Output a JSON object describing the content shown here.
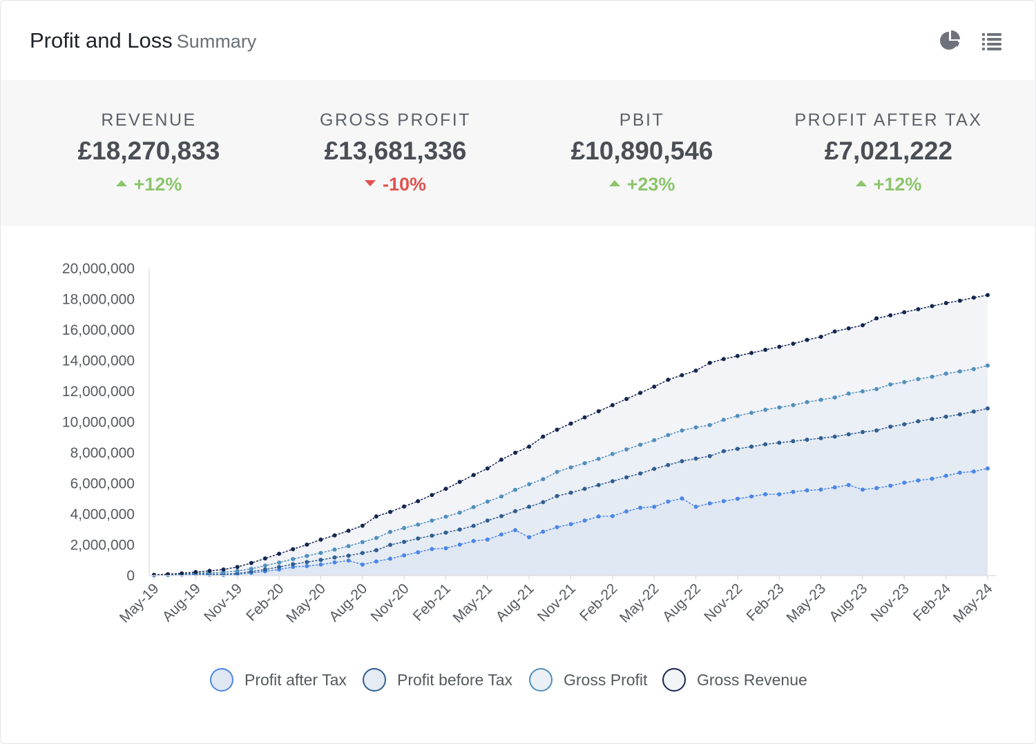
{
  "header": {
    "title": "Profit and Loss",
    "subtitle": "Summary",
    "icons": [
      "pie-chart-icon",
      "list-icon"
    ]
  },
  "kpis": [
    {
      "label": "REVENUE",
      "value": "£18,270,833",
      "change": "+12%",
      "direction": "up"
    },
    {
      "label": "GROSS PROFIT",
      "value": "£13,681,336",
      "change": "-10%",
      "direction": "down"
    },
    {
      "label": "PBIT",
      "value": "£10,890,546",
      "change": "+23%",
      "direction": "up"
    },
    {
      "label": "PROFIT AFTER TAX",
      "value": "£7,021,222",
      "change": "+12%",
      "direction": "up"
    }
  ],
  "colors": {
    "positive": "#8cc56b",
    "negative": "#e0524f",
    "series": [
      "#4a86e8",
      "#2f5d91",
      "#4f8fbd",
      "#14254f"
    ]
  },
  "chart_data": {
    "type": "area",
    "x": [
      "May-19",
      "Jun-19",
      "Jul-19",
      "Aug-19",
      "Sep-19",
      "Oct-19",
      "Nov-19",
      "Dec-19",
      "Jan-20",
      "Feb-20",
      "Mar-20",
      "Apr-20",
      "May-20",
      "Jun-20",
      "Jul-20",
      "Aug-20",
      "Sep-20",
      "Oct-20",
      "Nov-20",
      "Dec-20",
      "Jan-21",
      "Feb-21",
      "Mar-21",
      "Apr-21",
      "May-21",
      "Jun-21",
      "Jul-21",
      "Aug-21",
      "Sep-21",
      "Oct-21",
      "Nov-21",
      "Dec-21",
      "Jan-22",
      "Feb-22",
      "Mar-22",
      "Apr-22",
      "May-22",
      "Jun-22",
      "Jul-22",
      "Aug-22",
      "Sep-22",
      "Oct-22",
      "Nov-22",
      "Dec-22",
      "Jan-23",
      "Feb-23",
      "Mar-23",
      "Apr-23",
      "May-23",
      "Jun-23",
      "Jul-23",
      "Aug-23",
      "Sep-23",
      "Oct-23",
      "Nov-23",
      "Dec-23",
      "Jan-24",
      "Feb-24",
      "Mar-24",
      "Apr-24",
      "May-24"
    ],
    "x_tick_labels": [
      "May-19",
      "Aug-19",
      "Nov-19",
      "Feb-20",
      "May-20",
      "Aug-20",
      "Nov-20",
      "Feb-21",
      "May-21",
      "Aug-21",
      "Nov-21",
      "Feb-22",
      "May-22",
      "Aug-22",
      "Nov-22",
      "Feb-23",
      "May-23",
      "Aug-23",
      "Nov-23",
      "Feb-24",
      "May-24"
    ],
    "ylim": [
      0,
      20000000
    ],
    "y_ticks": [
      "0",
      "2,000,000",
      "4,000,000",
      "6,000,000",
      "8,000,000",
      "10,000,000",
      "12,000,000",
      "14,000,000",
      "16,000,000",
      "18,000,000",
      "20,000,000"
    ],
    "grid": false,
    "legend": "bottom",
    "series": [
      {
        "name": "Profit after Tax",
        "values": [
          20000,
          40000,
          60000,
          90000,
          60000,
          40000,
          80000,
          180000,
          280000,
          400000,
          560000,
          620000,
          720000,
          860000,
          980000,
          720000,
          920000,
          1100000,
          1320000,
          1520000,
          1730000,
          1780000,
          2020000,
          2250000,
          2350000,
          2680000,
          2960000,
          2500000,
          2860000,
          3150000,
          3350000,
          3580000,
          3850000,
          3880000,
          4180000,
          4420000,
          4480000,
          4820000,
          5020000,
          4480000,
          4700000,
          4850000,
          5000000,
          5150000,
          5300000,
          5300000,
          5450000,
          5550000,
          5600000,
          5750000,
          5900000,
          5600000,
          5700000,
          5850000,
          6050000,
          6200000,
          6300000,
          6500000,
          6700000,
          6780000,
          6980000
        ]
      },
      {
        "name": "Profit before Tax",
        "values": [
          30000,
          50000,
          80000,
          120000,
          110000,
          90000,
          140000,
          260000,
          400000,
          560000,
          740000,
          880000,
          1020000,
          1180000,
          1300000,
          1470000,
          1650000,
          2000000,
          2200000,
          2420000,
          2600000,
          2800000,
          3000000,
          3240000,
          3580000,
          3870000,
          4200000,
          4480000,
          4780000,
          5180000,
          5400000,
          5650000,
          5900000,
          6150000,
          6400000,
          6650000,
          6950000,
          7200000,
          7450000,
          7620000,
          7780000,
          8100000,
          8250000,
          8400000,
          8550000,
          8650000,
          8750000,
          8850000,
          8950000,
          9050000,
          9200000,
          9350000,
          9450000,
          9700000,
          9850000,
          10050000,
          10200000,
          10350000,
          10500000,
          10680000,
          10890000
        ]
      },
      {
        "name": "Gross Profit",
        "values": [
          40000,
          70000,
          110000,
          170000,
          190000,
          220000,
          300000,
          440000,
          650000,
          850000,
          1080000,
          1280000,
          1480000,
          1700000,
          1920000,
          2180000,
          2450000,
          2850000,
          3100000,
          3320000,
          3580000,
          3840000,
          4100000,
          4460000,
          4820000,
          5150000,
          5580000,
          5950000,
          6280000,
          6750000,
          7050000,
          7320000,
          7600000,
          7920000,
          8220000,
          8520000,
          8820000,
          9150000,
          9450000,
          9650000,
          9800000,
          10150000,
          10400000,
          10600000,
          10800000,
          10950000,
          11100000,
          11300000,
          11450000,
          11600000,
          11850000,
          12000000,
          12150000,
          12450000,
          12600000,
          12800000,
          12950000,
          13150000,
          13300000,
          13450000,
          13680000
        ]
      },
      {
        "name": "Gross Revenue",
        "values": [
          50000,
          90000,
          150000,
          230000,
          310000,
          400000,
          560000,
          820000,
          1120000,
          1420000,
          1720000,
          2020000,
          2340000,
          2620000,
          2920000,
          3250000,
          3850000,
          4150000,
          4500000,
          4850000,
          5250000,
          5650000,
          6100000,
          6550000,
          6980000,
          7550000,
          8000000,
          8400000,
          9050000,
          9500000,
          9900000,
          10300000,
          10700000,
          11100000,
          11500000,
          11900000,
          12300000,
          12750000,
          13050000,
          13350000,
          13850000,
          14100000,
          14300000,
          14500000,
          14700000,
          14900000,
          15100000,
          15350000,
          15550000,
          15900000,
          16100000,
          16300000,
          16750000,
          16950000,
          17150000,
          17350000,
          17550000,
          17750000,
          17900000,
          18100000,
          18270000
        ]
      }
    ]
  }
}
